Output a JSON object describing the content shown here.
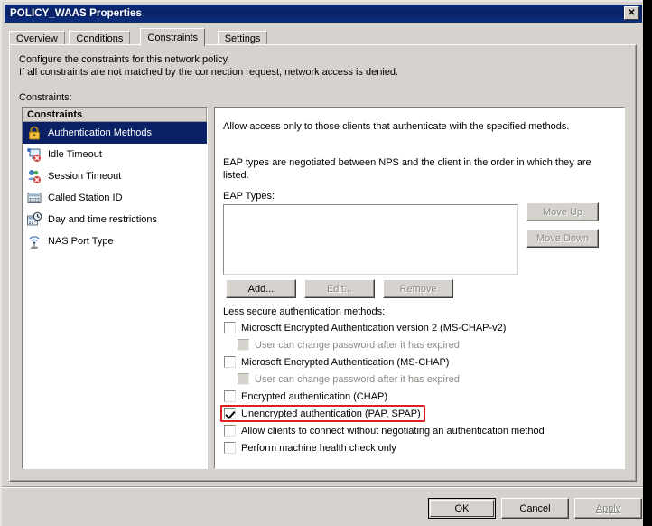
{
  "window": {
    "title": "POLICY_WAAS Properties",
    "close_label": "✕"
  },
  "tabs": [
    {
      "label": "Overview",
      "selected": false
    },
    {
      "label": "Conditions",
      "selected": false
    },
    {
      "label": "Constraints",
      "selected": true
    },
    {
      "label": "Settings",
      "selected": false
    }
  ],
  "description": {
    "line1": "Configure the constraints for this network policy.",
    "line2": "If all constraints are not matched by the connection request, network access is denied.",
    "constraints_label": "Constraints:"
  },
  "constraints_list": {
    "header": "Constraints",
    "items": [
      {
        "label": "Authentication Methods",
        "icon": "lock-icon",
        "selected": true
      },
      {
        "label": "Idle Timeout",
        "icon": "idle-timeout-icon",
        "selected": false
      },
      {
        "label": "Session Timeout",
        "icon": "session-timeout-icon",
        "selected": false
      },
      {
        "label": "Called Station ID",
        "icon": "called-station-id-icon",
        "selected": false
      },
      {
        "label": "Day and time restrictions",
        "icon": "calendar-clock-icon",
        "selected": false
      },
      {
        "label": "NAS Port Type",
        "icon": "nas-port-type-icon",
        "selected": false
      }
    ]
  },
  "panel": {
    "allow_text": "Allow access only to those clients that authenticate with the specified methods.",
    "eap_info_line1": "EAP types are negotiated between NPS and the client in the order in which they are",
    "eap_info_line2": "listed.",
    "eap_types_label": "EAP Types:",
    "eap_types_values": [],
    "buttons": {
      "move_up": {
        "label": "Move Up",
        "enabled": false
      },
      "move_down": {
        "label": "Move Down",
        "enabled": false
      },
      "add": {
        "label": "Add...",
        "enabled": true
      },
      "edit": {
        "label": "Edit...",
        "enabled": false
      },
      "remove": {
        "label": "Remove",
        "enabled": false
      }
    },
    "less_secure_label": "Less secure authentication methods:",
    "checkboxes": [
      {
        "label": "Microsoft Encrypted Authentication version 2 (MS-CHAP-v2)",
        "checked": false,
        "enabled": true,
        "indent": false
      },
      {
        "label": "User can change password after it has expired",
        "checked": false,
        "enabled": false,
        "indent": true
      },
      {
        "label": "Microsoft Encrypted Authentication (MS-CHAP)",
        "checked": false,
        "enabled": true,
        "indent": false
      },
      {
        "label": "User can change password after it has expired",
        "checked": false,
        "enabled": false,
        "indent": true
      },
      {
        "label": "Encrypted authentication (CHAP)",
        "checked": false,
        "enabled": true,
        "indent": false
      },
      {
        "label": "Unencrypted authentication (PAP, SPAP)",
        "checked": true,
        "enabled": true,
        "indent": false,
        "highlighted": true
      },
      {
        "label": "Allow clients to connect without negotiating an authentication method",
        "checked": false,
        "enabled": true,
        "indent": false
      },
      {
        "label": "Perform machine health check only",
        "checked": false,
        "enabled": true,
        "indent": false
      }
    ]
  },
  "footer": {
    "ok": {
      "label": "OK",
      "enabled": true,
      "default": true
    },
    "cancel": {
      "label": "Cancel",
      "enabled": true
    },
    "apply": {
      "label": "Apply",
      "enabled": false
    }
  },
  "colors": {
    "titlebar": "#0a2265",
    "selection": "#0a2265",
    "dialog_face": "#d6d3ce",
    "highlight_outline": "#e02020"
  }
}
